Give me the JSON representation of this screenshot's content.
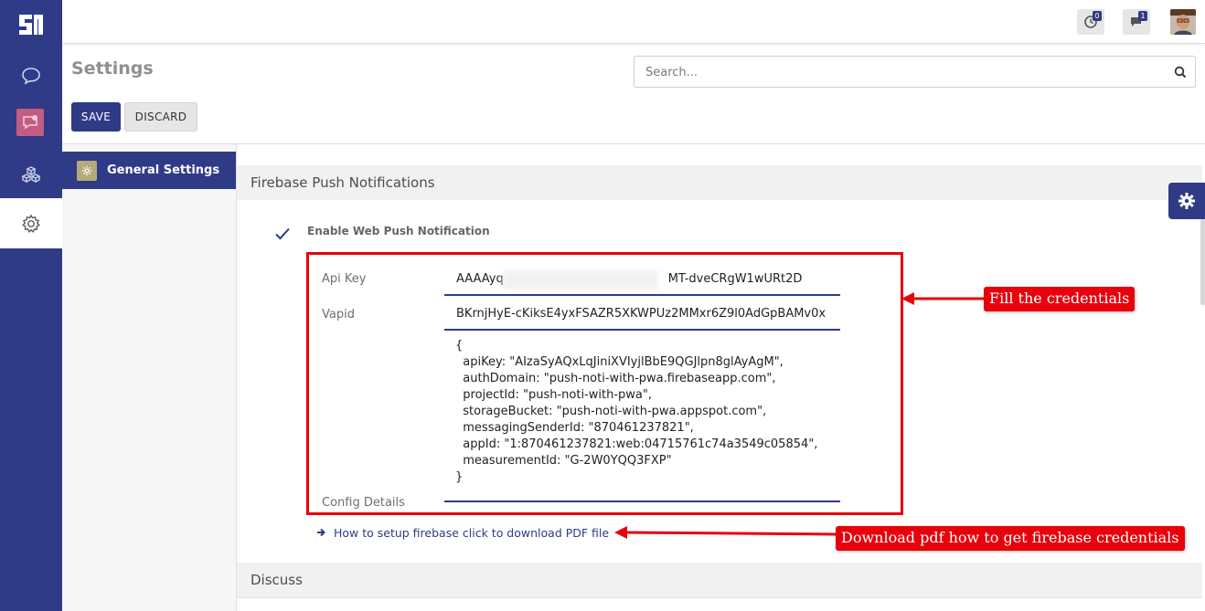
{
  "nav": {
    "items": [
      {
        "icon": "chat-icon"
      },
      {
        "icon": "app-discuss-icon"
      },
      {
        "icon": "cubes-icon"
      },
      {
        "icon": "gear-icon",
        "active": true
      }
    ]
  },
  "topbar": {
    "activity_count": "0",
    "messages_count": "1"
  },
  "control_panel": {
    "title": "Settings",
    "search_placeholder": "Search...",
    "save_label": "SAVE",
    "discard_label": "DISCARD"
  },
  "sidebar": {
    "items": [
      {
        "label": "General Settings"
      }
    ]
  },
  "sections": {
    "firebase_title": "Firebase Push Notifications",
    "discuss_title": "Discuss"
  },
  "firebase": {
    "enable_label": "Enable Web Push Notification",
    "api_key_label": "Api Key",
    "api_key_value": "AAAAyq",
    "api_key_value_tail": "MT-dveCRgW1wURt2D",
    "vapid_label": "Vapid",
    "vapid_value": "BKrnjHyE-cKiksE4yxFSAZR5XKWPUz2MMxr6Z9l0AdGpBAMv0x",
    "config_label": "Config Details",
    "config_value": "{\n  apiKey: \"AIzaSyAQxLqJiniXVIyjlBbE9QGJlpn8glAyAgM\",\n  authDomain: \"push-noti-with-pwa.firebaseapp.com\",\n  projectId: \"push-noti-with-pwa\",\n  storageBucket: \"push-noti-with-pwa.appspot.com\",\n  messagingSenderId: \"870461237821\",\n  appId: \"1:870461237821:web:04715761c74a3549c05854\",\n  measurementId: \"G-2W0YQQ3FXP\"\n}",
    "pdf_link": "How to setup firebase click to download PDF file"
  },
  "annotations": {
    "fill_credentials": "Fill the credentials",
    "download_pdf": "Download pdf how to get firebase credentials",
    "color": "#e8000b"
  },
  "colors": {
    "brand": "#2f3b86"
  }
}
